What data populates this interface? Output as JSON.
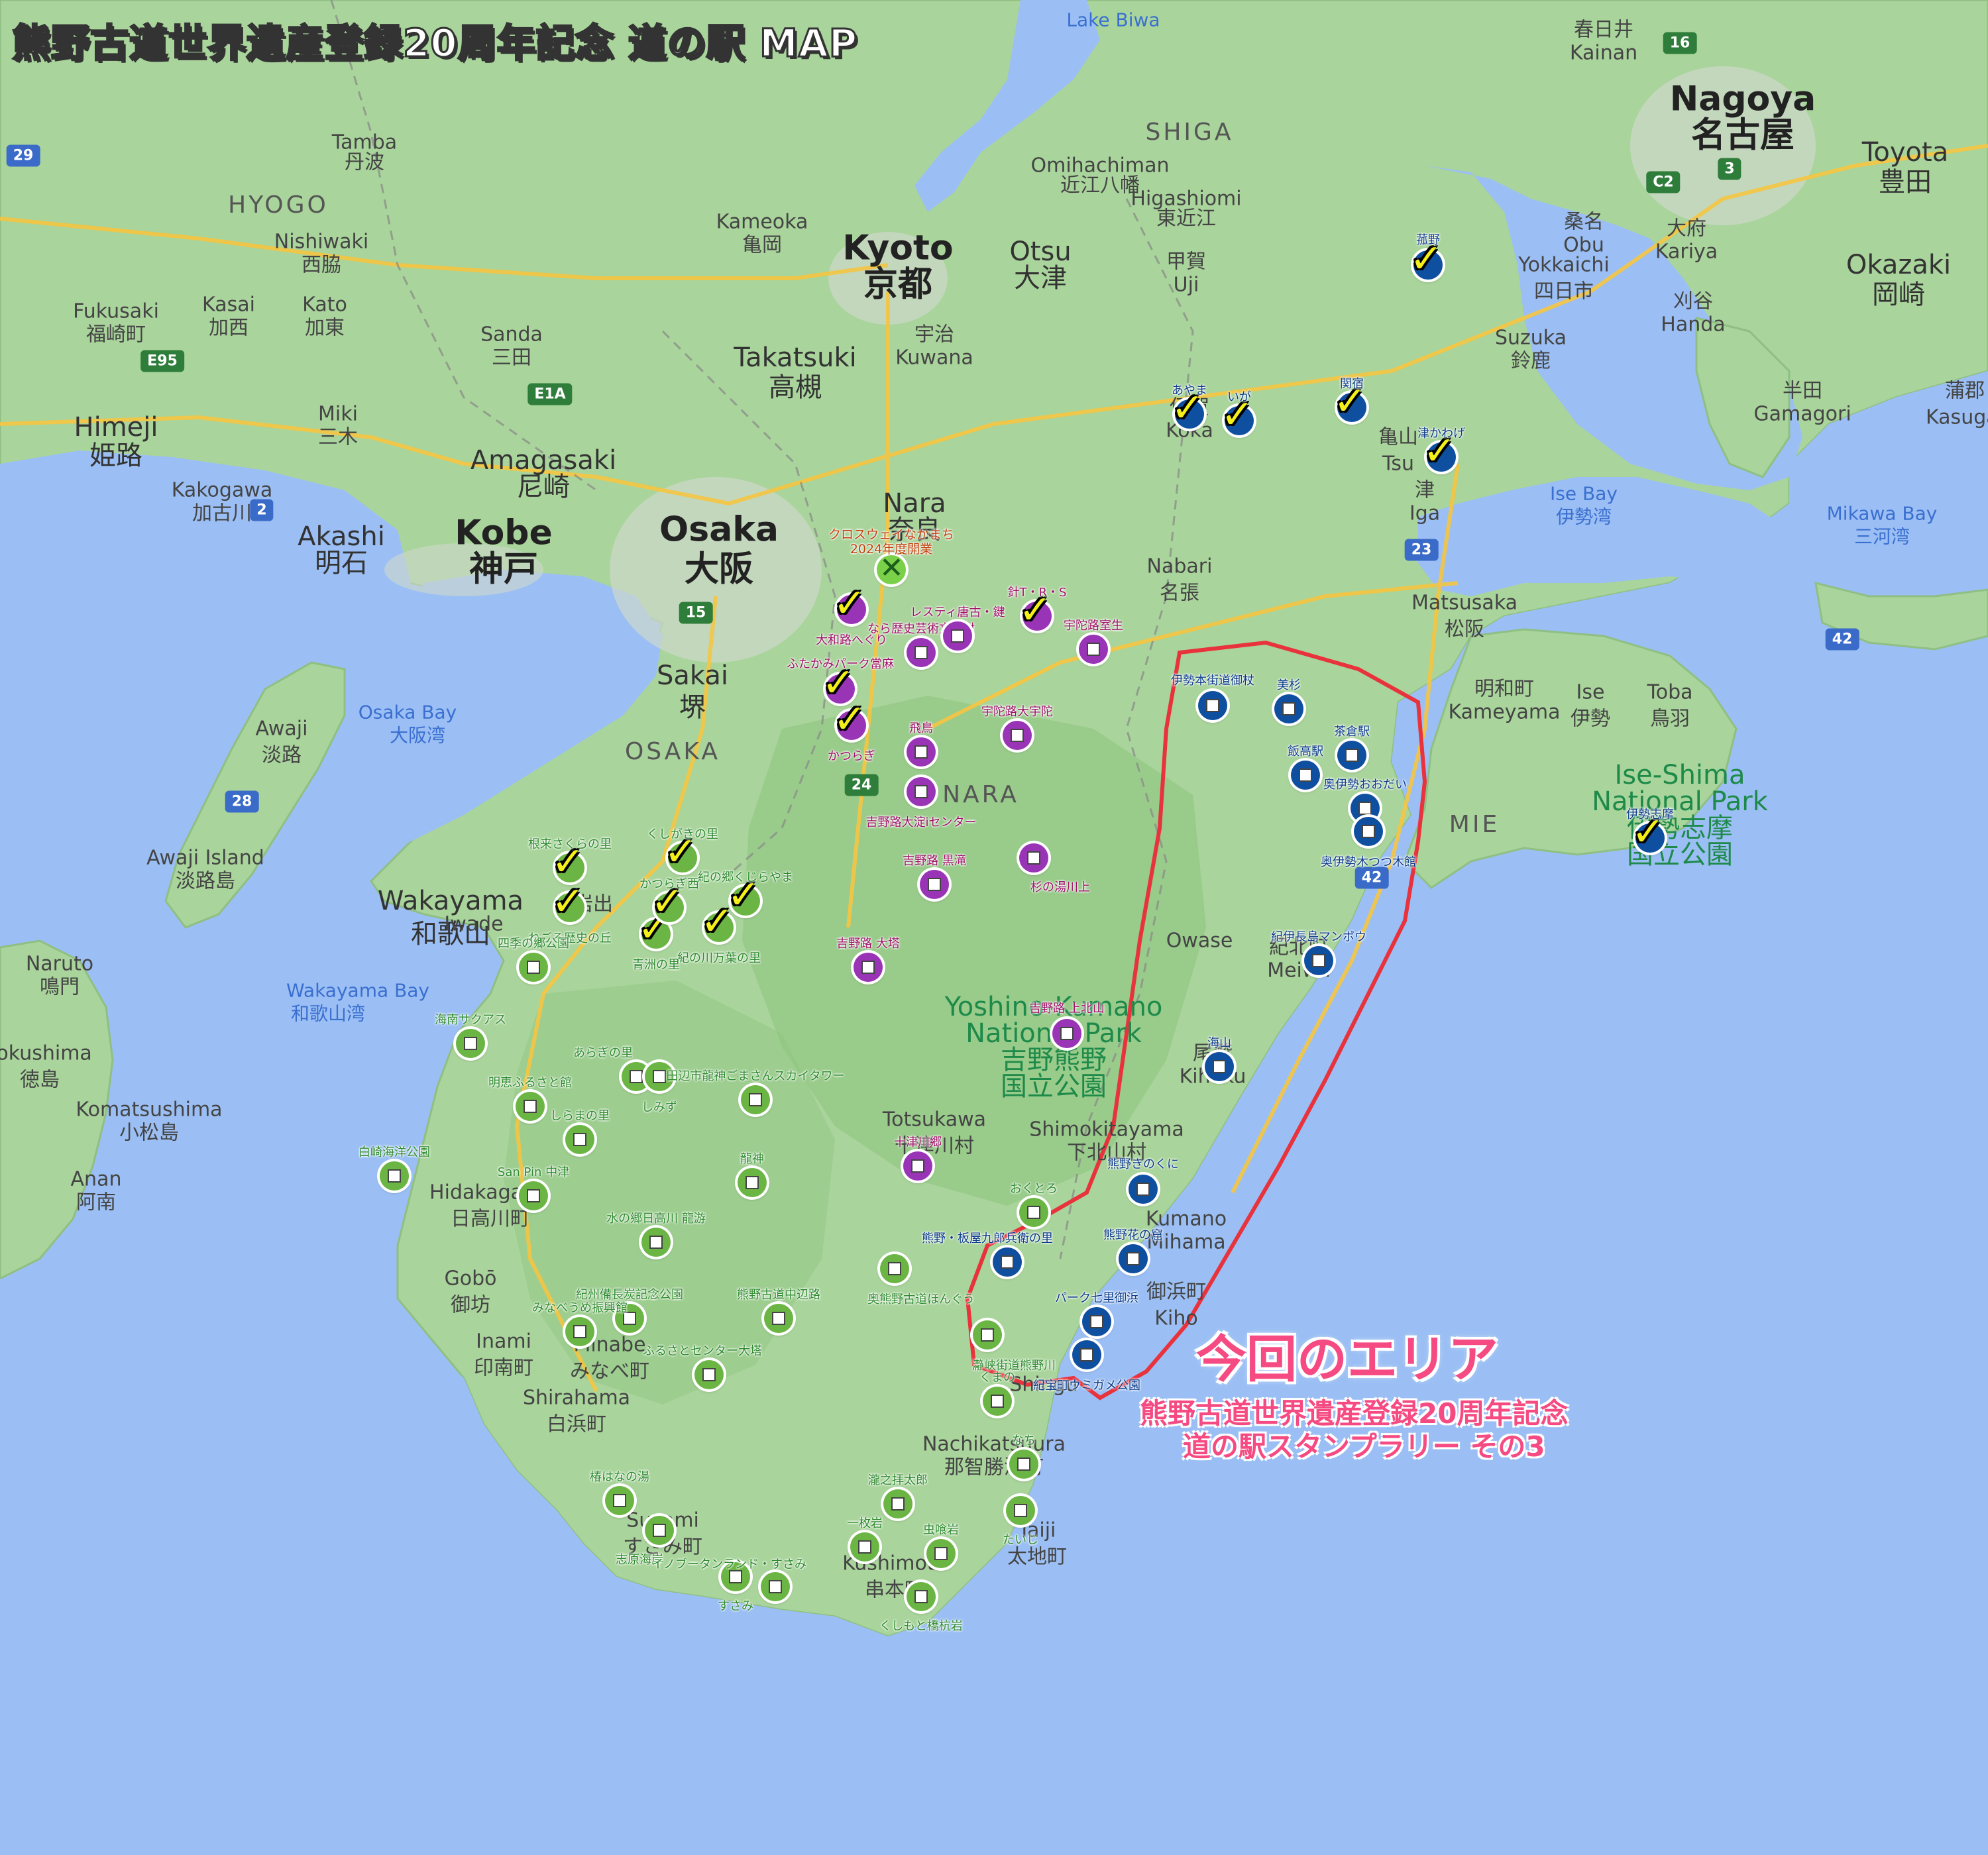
{
  "title": "熊野古道世界遺産登録20周年記念 道の駅 MAP",
  "area_callout": {
    "heading": "今回のエリア",
    "line1": "熊野古道世界遺産登録20周年記念",
    "line2": "道の駅スタンプラリー その3"
  },
  "place_labels": [
    {
      "text": "Nagoya",
      "cls": "big"
    },
    {
      "text": "名古屋",
      "cls": "big"
    },
    {
      "text": "Kyoto",
      "cls": "big"
    },
    {
      "text": "京都",
      "cls": "big"
    },
    {
      "text": "Osaka",
      "cls": "big"
    },
    {
      "text": "大阪",
      "cls": "big"
    },
    {
      "text": "Kobe",
      "cls": "big"
    },
    {
      "text": "神戸",
      "cls": "big"
    },
    {
      "text": "Himeji",
      "cls": ""
    },
    {
      "text": "姫路",
      "cls": ""
    },
    {
      "text": "Wakayama",
      "cls": ""
    },
    {
      "text": "和歌山",
      "cls": ""
    },
    {
      "text": "Sakai",
      "cls": ""
    },
    {
      "text": "堺",
      "cls": ""
    },
    {
      "text": "Nara",
      "cls": ""
    },
    {
      "text": "奈良",
      "cls": ""
    },
    {
      "text": "Otsu",
      "cls": ""
    },
    {
      "text": "大津",
      "cls": ""
    },
    {
      "text": "Takatsuki",
      "cls": ""
    },
    {
      "text": "高槻",
      "cls": ""
    },
    {
      "text": "Amagasaki",
      "cls": ""
    },
    {
      "text": "尼崎",
      "cls": ""
    },
    {
      "text": "Akashi",
      "cls": ""
    },
    {
      "text": "明石",
      "cls": ""
    },
    {
      "text": "Toyota",
      "cls": ""
    },
    {
      "text": "豊田",
      "cls": ""
    },
    {
      "text": "Okazaki",
      "cls": ""
    },
    {
      "text": "岡崎",
      "cls": ""
    },
    {
      "text": "Yokkaichi",
      "cls": "small"
    },
    {
      "text": "四日市",
      "cls": "small"
    },
    {
      "text": "Suzuka",
      "cls": "small"
    },
    {
      "text": "鈴鹿",
      "cls": "small"
    },
    {
      "text": "Matsusaka",
      "cls": "small"
    },
    {
      "text": "松阪",
      "cls": "small"
    },
    {
      "text": "Ise",
      "cls": "small"
    },
    {
      "text": "伊勢",
      "cls": "small"
    },
    {
      "text": "Toba",
      "cls": "small"
    },
    {
      "text": "鳥羽",
      "cls": "small"
    },
    {
      "text": "Nabari",
      "cls": "small"
    },
    {
      "text": "名張",
      "cls": "small"
    },
    {
      "text": "Kameoka",
      "cls": "small"
    },
    {
      "text": "亀岡",
      "cls": "small"
    },
    {
      "text": "Omihachiman",
      "cls": "small"
    },
    {
      "text": "近江八幡",
      "cls": "small"
    },
    {
      "text": "Higashiomi",
      "cls": "small"
    },
    {
      "text": "東近江",
      "cls": "small"
    },
    {
      "text": "Tamba",
      "cls": "small"
    },
    {
      "text": "丹波",
      "cls": "small"
    },
    {
      "text": "Nishiwaki",
      "cls": "small"
    },
    {
      "text": "西脇",
      "cls": "small"
    },
    {
      "text": "Kakogawa",
      "cls": "small"
    },
    {
      "text": "加古川",
      "cls": "small"
    },
    {
      "text": "Sanda",
      "cls": "small"
    },
    {
      "text": "三田",
      "cls": "small"
    },
    {
      "text": "Kato",
      "cls": "small"
    },
    {
      "text": "加東",
      "cls": "small"
    },
    {
      "text": "Kasai",
      "cls": "small"
    },
    {
      "text": "加西",
      "cls": "small"
    },
    {
      "text": "Fukusaki",
      "cls": "small"
    },
    {
      "text": "福崎町",
      "cls": "small"
    },
    {
      "text": "Miki",
      "cls": "small"
    },
    {
      "text": "三木",
      "cls": "small"
    },
    {
      "text": "Awaji",
      "cls": "small"
    },
    {
      "text": "淡路",
      "cls": "small"
    },
    {
      "text": "Awaji Island",
      "cls": "small"
    },
    {
      "text": "淡路島",
      "cls": "small"
    },
    {
      "text": "Naruto",
      "cls": "small"
    },
    {
      "text": "鳴門",
      "cls": "small"
    },
    {
      "text": "Tokushima",
      "cls": "small"
    },
    {
      "text": "徳島",
      "cls": "small"
    },
    {
      "text": "Komatsushima",
      "cls": "small"
    },
    {
      "text": "小松島",
      "cls": "small"
    },
    {
      "text": "Anan",
      "cls": "small"
    },
    {
      "text": "阿南",
      "cls": "small"
    },
    {
      "text": "Hidakagawa",
      "cls": "small"
    },
    {
      "text": "日高川町",
      "cls": "small"
    },
    {
      "text": "Gobō",
      "cls": "small"
    },
    {
      "text": "御坊",
      "cls": "small"
    },
    {
      "text": "Inami",
      "cls": "small"
    },
    {
      "text": "印南町",
      "cls": "small"
    },
    {
      "text": "Minabe",
      "cls": "small"
    },
    {
      "text": "みなべ町",
      "cls": "small"
    },
    {
      "text": "Shirahama",
      "cls": "small"
    },
    {
      "text": "白浜町",
      "cls": "small"
    },
    {
      "text": "Susami",
      "cls": "small"
    },
    {
      "text": "すさみ町",
      "cls": "small"
    },
    {
      "text": "Kushimoto",
      "cls": "small"
    },
    {
      "text": "串本町",
      "cls": "small"
    },
    {
      "text": "Nachikatsuura",
      "cls": "small"
    },
    {
      "text": "那智勝浦町",
      "cls": "small"
    },
    {
      "text": "Taiji",
      "cls": "small"
    },
    {
      "text": "太地町",
      "cls": "small"
    },
    {
      "text": "Shingu",
      "cls": "small"
    },
    {
      "text": "Totsukawa",
      "cls": "small"
    },
    {
      "text": "十津川村",
      "cls": "small"
    },
    {
      "text": "Shimokitayama",
      "cls": "small"
    },
    {
      "text": "下北山村",
      "cls": "small"
    },
    {
      "text": "Kumano",
      "cls": "small"
    },
    {
      "text": "Mihama",
      "cls": "small"
    },
    {
      "text": "御浜町",
      "cls": "small"
    },
    {
      "text": "Kiho",
      "cls": "small"
    },
    {
      "text": "Owase",
      "cls": "small"
    },
    {
      "text": "尾鷲",
      "cls": "small"
    },
    {
      "text": "Kihoku",
      "cls": "small"
    },
    {
      "text": "紀北町",
      "cls": "small"
    },
    {
      "text": "Meiwa",
      "cls": "small"
    },
    {
      "text": "明和町",
      "cls": "small"
    },
    {
      "text": "Kameyama",
      "cls": "small"
    },
    {
      "text": "亀山",
      "cls": "small"
    },
    {
      "text": "Tsu",
      "cls": "small"
    },
    {
      "text": "津",
      "cls": "small"
    },
    {
      "text": "Iga",
      "cls": "small"
    },
    {
      "text": "伊賀",
      "cls": "small"
    },
    {
      "text": "Koka",
      "cls": "small"
    },
    {
      "text": "甲賀",
      "cls": "small"
    },
    {
      "text": "Uji",
      "cls": "small"
    },
    {
      "text": "宇治",
      "cls": "small"
    },
    {
      "text": "Kuwana",
      "cls": "small"
    },
    {
      "text": "桑名",
      "cls": "small"
    },
    {
      "text": "Obu",
      "cls": "small"
    },
    {
      "text": "大府",
      "cls": "small"
    },
    {
      "text": "Kariya",
      "cls": "small"
    },
    {
      "text": "刈谷",
      "cls": "small"
    },
    {
      "text": "Handa",
      "cls": "small"
    },
    {
      "text": "半田",
      "cls": "small"
    },
    {
      "text": "Gamagori",
      "cls": "small"
    },
    {
      "text": "蒲郡",
      "cls": "small"
    },
    {
      "text": "Kasugai",
      "cls": "small"
    },
    {
      "text": "春日井",
      "cls": "small"
    },
    {
      "text": "Kainan",
      "cls": "small"
    },
    {
      "text": "Iwade",
      "cls": "small"
    },
    {
      "text": "岩出",
      "cls": "small"
    }
  ],
  "region_labels": [
    "HYOGO",
    "SHIGA",
    "OSAKA",
    "NARA",
    "MIE"
  ],
  "water_labels": [
    {
      "en": "Osaka Bay",
      "ja": "大阪湾"
    },
    {
      "en": "Wakayama Bay",
      "ja": "和歌山湾"
    },
    {
      "en": "Ise Bay",
      "ja": "伊勢湾"
    },
    {
      "en": "Mikawa Bay",
      "ja": "三河湾"
    },
    {
      "en": "Lake Biwa",
      "ja": ""
    }
  ],
  "parks": [
    {
      "en": "Yoshino-Kumano",
      "en2": "National Park",
      "ja1": "吉野熊野",
      "ja2": "国立公園"
    },
    {
      "en": "Ise-Shima",
      "en2": "National Park",
      "ja1": "伊勢志摩",
      "ja2": "国立公園"
    }
  ],
  "road_shields": [
    "29",
    "2",
    "E95",
    "E1A",
    "15",
    "24",
    "28",
    "23",
    "42",
    "42",
    "16",
    "3",
    "C2"
  ],
  "stations_green": [
    {
      "name": "根来さくらの里",
      "check": true
    },
    {
      "name": "くしがきの里",
      "check": true
    },
    {
      "name": "紀の川万葉の里",
      "check": true
    },
    {
      "name": "青洲の里",
      "check": true
    },
    {
      "name": "かつらぎ西",
      "check": true
    },
    {
      "name": "紀の郷くじらやま",
      "check": true
    },
    {
      "name": "ねごろ歴史の丘",
      "check": true
    },
    {
      "name": "四季の郷公園",
      "check": false
    },
    {
      "name": "海南サクアス",
      "check": false
    },
    {
      "name": "あらぎの里",
      "check": false
    },
    {
      "name": "しみず",
      "check": false
    },
    {
      "name": "明恵ふるさと館",
      "check": false
    },
    {
      "name": "しらまの里",
      "check": false
    },
    {
      "name": "白崎海洋公園",
      "check": false
    },
    {
      "name": "San Pin 中津",
      "check": false
    },
    {
      "name": "田辺市龍神ごまさんスカイタワー",
      "check": false
    },
    {
      "name": "龍神",
      "check": false
    },
    {
      "name": "水の郷日高川 龍游",
      "check": false
    },
    {
      "name": "紀州備長炭記念公園",
      "check": false
    },
    {
      "name": "みなべうめ振興館",
      "check": false
    },
    {
      "name": "ふるさとセンター大塔",
      "check": false
    },
    {
      "name": "熊野古道中辺路",
      "check": false
    },
    {
      "name": "奥熊野古道ほんぐう",
      "check": false
    },
    {
      "name": "瀞峡街道熊野川",
      "check": false
    },
    {
      "name": "おくとろ",
      "check": false
    },
    {
      "name": "椿はなの湯",
      "check": false
    },
    {
      "name": "志原海岸",
      "check": false
    },
    {
      "name": "すさみ",
      "check": false
    },
    {
      "name": "イノブータンランド・すさみ",
      "check": false
    },
    {
      "name": "一枚岩",
      "check": false
    },
    {
      "name": "瀧之拝太郎",
      "check": false
    },
    {
      "name": "虫喰岩",
      "check": false
    },
    {
      "name": "くしもと橋杭岩",
      "check": false
    },
    {
      "name": "なち",
      "check": false
    },
    {
      "name": "たいじ",
      "check": false
    },
    {
      "name": "くまの",
      "check": false
    }
  ],
  "stations_purple": [
    {
      "name": "大和路へぐり",
      "check": true
    },
    {
      "name": "ふたかみパーク當麻",
      "check": true
    },
    {
      "name": "かつらぎ",
      "check": true
    },
    {
      "name": "針T・R・S",
      "check": true
    },
    {
      "name": "なら歴史芸術文化村",
      "check": false
    },
    {
      "name": "レスティ唐古・鍵",
      "check": false
    },
    {
      "name": "宇陀路室生",
      "check": false
    },
    {
      "name": "飛鳥",
      "check": false
    },
    {
      "name": "宇陀路大宇陀",
      "check": false
    },
    {
      "name": "吉野路大淀iセンター",
      "check": false
    },
    {
      "name": "吉野路 黒滝",
      "check": false
    },
    {
      "name": "杉の湯川上",
      "check": false
    },
    {
      "name": "吉野路 大塔",
      "check": false
    },
    {
      "name": "吉野路 上北山",
      "check": false
    },
    {
      "name": "十津川郷",
      "check": false
    }
  ],
  "stations_blue": [
    {
      "name": "菰野",
      "check": true
    },
    {
      "name": "あやま",
      "check": true
    },
    {
      "name": "いが",
      "check": true
    },
    {
      "name": "関宿",
      "check": true
    },
    {
      "name": "津かわげ",
      "check": true
    },
    {
      "name": "伊勢志摩",
      "check": true
    },
    {
      "name": "伊勢本街道御杖",
      "check": false
    },
    {
      "name": "美杉",
      "check": false
    },
    {
      "name": "茶倉駅",
      "check": false
    },
    {
      "name": "飯高駅",
      "check": false
    },
    {
      "name": "奥伊勢おおだい",
      "check": false
    },
    {
      "name": "奥伊勢木つつ木館",
      "check": false
    },
    {
      "name": "紀伊長島マンボウ",
      "check": false
    },
    {
      "name": "海山",
      "check": false
    },
    {
      "name": "熊野きのくに",
      "check": false
    },
    {
      "name": "熊野・板屋九郎兵衛の里",
      "check": false
    },
    {
      "name": "熊野花の窟",
      "check": false
    },
    {
      "name": "パーク七里御浜",
      "check": false
    },
    {
      "name": "紀宝町ウミガメ公園",
      "check": false
    }
  ],
  "special_station": {
    "name": "クロスウェイなかまち",
    "note": "2024年度開業"
  },
  "colors": {
    "land": "#a9d49b",
    "sea": "#9bbff4",
    "green": "#6ab543",
    "purple": "#9a34b6",
    "blue": "#0f4fa0",
    "check": "#f2ef1a",
    "area": "#f54a82",
    "outline": "#e8323c"
  }
}
